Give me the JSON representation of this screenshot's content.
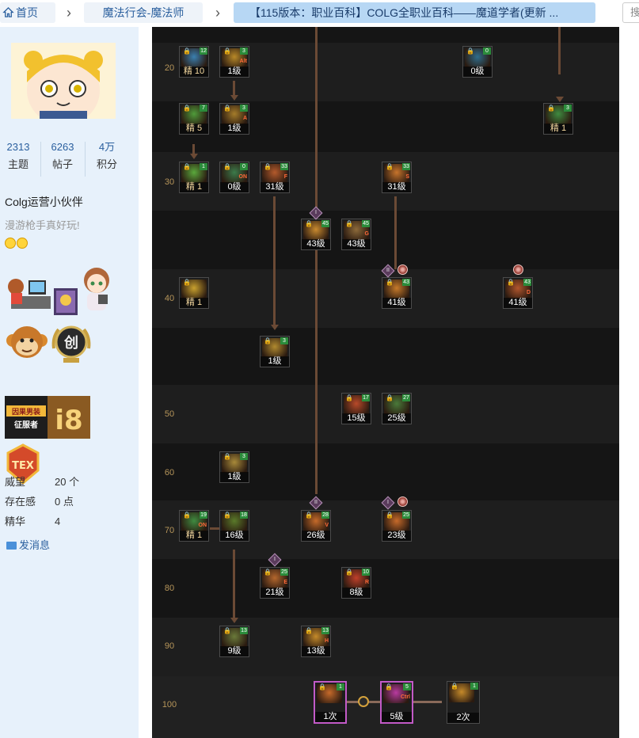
{
  "breadcrumb": {
    "home": "首页",
    "section": "魔法行会-魔法师",
    "thread": "【115版本：职业百科】COLG全职业百科——魔道学者(更新 ...",
    "search_stub": "搜"
  },
  "profile": {
    "stats": [
      {
        "value": "2313",
        "label": "主题"
      },
      {
        "value": "6263",
        "label": "帖子"
      },
      {
        "value": "4万",
        "label": "积分"
      }
    ],
    "username": "Colg运营小伙伴",
    "motto": "漫游枪手真好玩!",
    "medals": [
      "运营小伙伴",
      "猴子",
      "创",
      "因果男装征服者",
      "i8",
      "TEX"
    ],
    "info": [
      {
        "key": "威望",
        "value": "20 个"
      },
      {
        "key": "存在感",
        "value": "0 点"
      },
      {
        "key": "精华",
        "value": "4"
      }
    ],
    "send_message": "发消息"
  },
  "tree": {
    "levels": [
      "20",
      "30",
      "40",
      "50",
      "60",
      "70",
      "80",
      "90",
      "100"
    ],
    "skills": [
      {
        "id": "s20a",
        "level_text": "精 10",
        "badge": "12",
        "key": "",
        "elite": true,
        "color": "#3a7fb0",
        "icon": "broom-icon"
      },
      {
        "id": "s20b",
        "level_text": "1级",
        "badge": "3",
        "key": "Alt",
        "elite": false,
        "color": "#b88928",
        "icon": "lantern-icon"
      },
      {
        "id": "s20c",
        "level_text": "0级",
        "badge": "0",
        "key": "",
        "elite": false,
        "color": "#2f6d8c",
        "icon": "wand-icon"
      },
      {
        "id": "s25a",
        "level_text": "精 5",
        "badge": "7",
        "key": "",
        "elite": true,
        "color": "#4f9b3a",
        "icon": "swirl-icon"
      },
      {
        "id": "s25b",
        "level_text": "1级",
        "badge": "3",
        "key": "A",
        "elite": false,
        "color": "#a57c2a",
        "icon": "fan-icon"
      },
      {
        "id": "s25c",
        "level_text": "精 1",
        "badge": "3",
        "key": "",
        "elite": true,
        "color": "#3f8b40",
        "icon": "hat-icon"
      },
      {
        "id": "s30a",
        "level_text": "精 1",
        "badge": "1",
        "key": "",
        "elite": true,
        "color": "#5aa83c",
        "icon": "swirl-icon"
      },
      {
        "id": "s30b",
        "level_text": "0级",
        "badge": "0",
        "key": "ON",
        "elite": false,
        "color": "#3c7b4b",
        "icon": "net-icon"
      },
      {
        "id": "s30c",
        "level_text": "31级",
        "badge": "33",
        "key": "F",
        "elite": false,
        "color": "#b45a2c",
        "icon": "cloud-icon"
      },
      {
        "id": "s30d",
        "level_text": "31级",
        "badge": "33",
        "key": "S",
        "elite": false,
        "color": "#c7742c",
        "icon": "pumpkin-icon"
      },
      {
        "id": "s35a",
        "level_text": "43级",
        "badge": "45",
        "key": "",
        "elite": false,
        "color": "#c98a2f",
        "icon": "orb-icon"
      },
      {
        "id": "s35b",
        "level_text": "43级",
        "badge": "45",
        "key": "G",
        "elite": false,
        "color": "#8d6a3a",
        "icon": "staff-icon"
      },
      {
        "id": "s40a",
        "level_text": "精 1",
        "badge": "",
        "key": "",
        "elite": true,
        "color": "#c9a12e",
        "icon": "sun-icon"
      },
      {
        "id": "s40b",
        "level_text": "41级",
        "badge": "43",
        "key": "",
        "elite": false,
        "color": "#c77a2a",
        "icon": "sack-icon"
      },
      {
        "id": "s40c",
        "level_text": "41级",
        "badge": "43",
        "key": "D",
        "elite": false,
        "color": "#b2562d",
        "icon": "spider-icon"
      },
      {
        "id": "s45a",
        "level_text": "1级",
        "badge": "3",
        "key": "",
        "elite": false,
        "color": "#b18a2f",
        "icon": "drill-icon"
      },
      {
        "id": "s50a",
        "level_text": "15级",
        "badge": "17",
        "key": "",
        "elite": false,
        "color": "#b84a2a",
        "icon": "imp-icon"
      },
      {
        "id": "s50b",
        "level_text": "25级",
        "badge": "27",
        "key": "",
        "elite": false,
        "color": "#4a7a3a",
        "icon": "candy-icon"
      },
      {
        "id": "s60a",
        "level_text": "1级",
        "badge": "3",
        "key": "",
        "elite": false,
        "color": "#a88a3a",
        "icon": "fan-icon"
      },
      {
        "id": "s70a",
        "level_text": "精 1",
        "badge": "19",
        "key": "ON",
        "elite": true,
        "color": "#3f8b40",
        "icon": "skull-icon"
      },
      {
        "id": "s70b",
        "level_text": "16级",
        "badge": "18",
        "key": "",
        "elite": false,
        "color": "#5a7a2a",
        "icon": "vortex-icon"
      },
      {
        "id": "s70c",
        "level_text": "26级",
        "badge": "28",
        "key": "V",
        "elite": false,
        "color": "#c56a2a",
        "icon": "blast-icon"
      },
      {
        "id": "s70d",
        "level_text": "23级",
        "badge": "25",
        "key": "",
        "elite": false,
        "color": "#c66a2a",
        "icon": "pumpkin-icon"
      },
      {
        "id": "s80a",
        "level_text": "21级",
        "badge": "25",
        "key": "E",
        "elite": false,
        "color": "#b5672d",
        "icon": "eye-icon"
      },
      {
        "id": "s80b",
        "level_text": "8级",
        "badge": "10",
        "key": "R",
        "elite": false,
        "color": "#c0402a",
        "icon": "ring-icon"
      },
      {
        "id": "s90a",
        "level_text": "9级",
        "badge": "13",
        "key": "",
        "elite": false,
        "color": "#6a7a3a",
        "icon": "shard-icon"
      },
      {
        "id": "s90b",
        "level_text": "13级",
        "badge": "13",
        "key": "H",
        "elite": false,
        "color": "#c58a2a",
        "icon": "bell-icon"
      },
      {
        "id": "s100a",
        "level_text": "1次",
        "badge": "1",
        "key": "",
        "elite": false,
        "color": "#c66a2a",
        "icon": "imp-icon",
        "awakening": true
      },
      {
        "id": "s100b",
        "level_text": "5级",
        "badge": "5",
        "key": "Ctrl",
        "elite": false,
        "color": "#b83aa0",
        "icon": "fan-icon",
        "awakening": true
      },
      {
        "id": "s100c",
        "level_text": "2次",
        "badge": "1",
        "key": "",
        "elite": false,
        "color": "#c58a2a",
        "icon": "portal-icon"
      }
    ],
    "rank_marks": [
      "I",
      "II",
      "I",
      "I",
      "II",
      "I"
    ]
  }
}
